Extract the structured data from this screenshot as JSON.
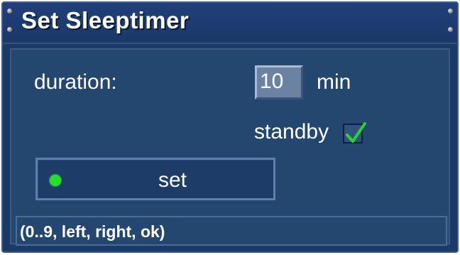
{
  "window": {
    "title": "Set Sleeptimer"
  },
  "form": {
    "duration_label": "duration:",
    "duration_value": "10",
    "duration_unit": "min",
    "standby_label": "standby",
    "standby_checked": true
  },
  "buttons": {
    "set_label": "set",
    "set_color_key": "green"
  },
  "help": {
    "text": "(0..9, left, right, ok)"
  },
  "colors": {
    "background": "#1c3a66",
    "panel": "#24476f",
    "key_green": "#22e026",
    "check_green": "#2fd12f",
    "text": "#ffffff"
  },
  "icons": {
    "checkbox": "checkmark-icon",
    "color_key": "green-dot-icon",
    "decor": "screw-icon"
  }
}
